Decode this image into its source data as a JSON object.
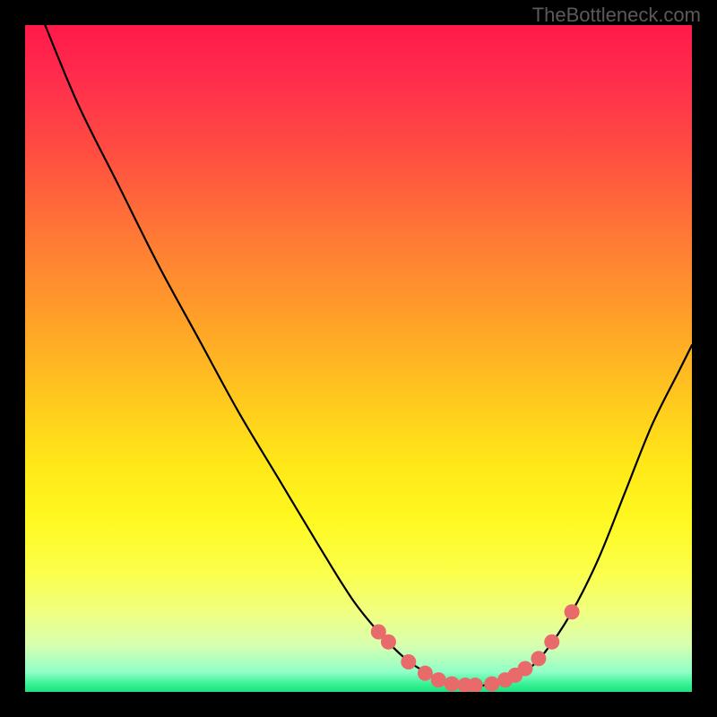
{
  "watermark": "TheBottleneck.com",
  "chart_data": {
    "type": "line",
    "title": "",
    "xlabel": "",
    "ylabel": "",
    "xlim": [
      0,
      100
    ],
    "ylim": [
      0,
      100
    ],
    "curve": {
      "name": "bottleneck-curve",
      "x": [
        3,
        8,
        14,
        20,
        26,
        32,
        38,
        44,
        49,
        53,
        57,
        60,
        63,
        66,
        69,
        72,
        75,
        78,
        82,
        86,
        90,
        94,
        98,
        100
      ],
      "y": [
        100,
        88,
        76,
        64,
        53,
        42,
        32,
        22,
        14,
        9,
        5,
        3,
        1.5,
        1,
        1,
        1.5,
        3,
        6,
        12,
        20,
        30,
        40,
        48,
        52
      ]
    },
    "markers": {
      "name": "highlight-points",
      "x": [
        53,
        54.5,
        57.5,
        60,
        62,
        64,
        66,
        67.5,
        70,
        72,
        73.5,
        75,
        77,
        79,
        82
      ],
      "y": [
        9,
        7.5,
        4.5,
        2.8,
        1.8,
        1.2,
        1,
        1,
        1.2,
        1.8,
        2.5,
        3.5,
        5,
        7.5,
        12
      ]
    },
    "gradient_stops": [
      {
        "pos": 0,
        "color": "#ff1a4a"
      },
      {
        "pos": 20,
        "color": "#ff5040"
      },
      {
        "pos": 44,
        "color": "#ffa028"
      },
      {
        "pos": 66,
        "color": "#ffe818"
      },
      {
        "pos": 88,
        "color": "#f0ff80"
      },
      {
        "pos": 100,
        "color": "#1ee080"
      }
    ]
  }
}
